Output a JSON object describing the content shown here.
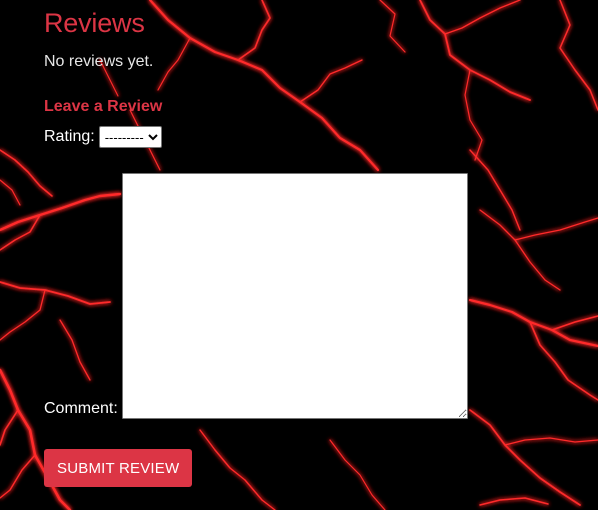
{
  "reviews": {
    "title": "Reviews",
    "empty_message": "No reviews yet."
  },
  "form": {
    "heading": "Leave a Review",
    "rating_label": "Rating:",
    "rating_selected": "---------",
    "comment_label": "Comment:",
    "comment_value": "",
    "submit_label": "SUBMIT REVIEW"
  },
  "colors": {
    "accent": "#dc3545",
    "background": "#000000",
    "lightning": "#ff2a2a"
  }
}
